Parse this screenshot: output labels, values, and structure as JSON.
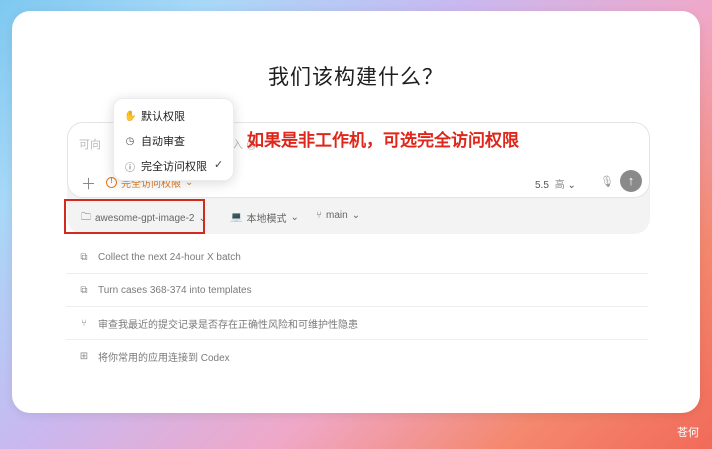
{
  "title": "我们该构建什么？",
  "composer": {
    "placeholder_start": "可向",
    "placeholder_end": "入 @",
    "permission_label": "完全访问权限",
    "model": "5.5",
    "quality": "高"
  },
  "bar": {
    "repo": "awesome-gpt-image-2",
    "mode": "本地模式",
    "branch": "main"
  },
  "dropdown": {
    "items": [
      "默认权限",
      "自动审查",
      "完全访问权限"
    ]
  },
  "annotation": "如果是非工作机，可选完全访问权限",
  "suggestions": [
    "Collect the next 24-hour X batch",
    "Turn cases 368-374 into templates",
    "审查我最近的提交记录是否存在正确性风险和可维护性隐患",
    "将你常用的应用连接到 Codex"
  ],
  "watermark": "苍何",
  "colors": {
    "accent_orange": "#e07a1f",
    "annotation_red": "#e0261a"
  }
}
